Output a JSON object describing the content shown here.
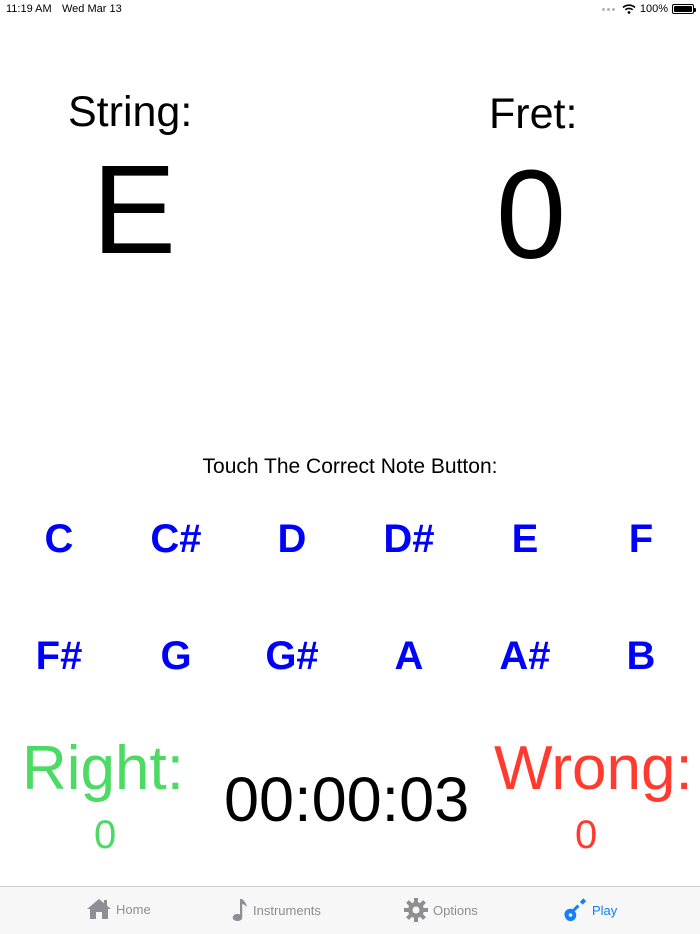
{
  "status_bar": {
    "time": "11:19 AM",
    "date": "Wed Mar 13",
    "battery": "100%"
  },
  "string": {
    "label": "String:",
    "value": "E"
  },
  "fret": {
    "label": "Fret:",
    "value": "0"
  },
  "instruction": "Touch The Correct Note Button:",
  "notes": [
    "C",
    "C#",
    "D",
    "D#",
    "E",
    "F",
    "F#",
    "G",
    "G#",
    "A",
    "A#",
    "B"
  ],
  "score": {
    "right_label": "Right:",
    "right_value": "0",
    "wrong_label": "Wrong:",
    "wrong_value": "0",
    "timer": "00:00:03"
  },
  "colors": {
    "note_button": "#0000ff",
    "right": "#4cd964",
    "wrong": "#ff3b30",
    "tab_active": "#147efb",
    "tab_inactive": "#8e8e93"
  },
  "tab_bar": {
    "tabs": [
      {
        "label": "Home",
        "icon": "house-icon"
      },
      {
        "label": "Instruments",
        "icon": "music-note-icon"
      },
      {
        "label": "Options",
        "icon": "gear-icon"
      },
      {
        "label": "Play",
        "icon": "guitar-icon"
      }
    ],
    "active": "Play"
  }
}
